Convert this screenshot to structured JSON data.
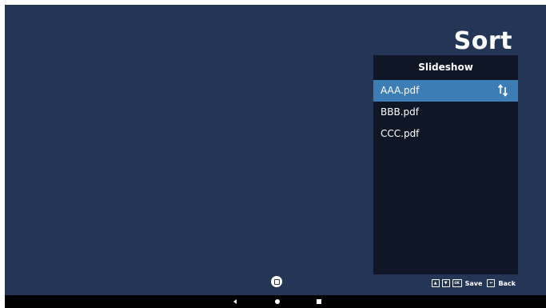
{
  "page": {
    "title": "Sort"
  },
  "panel": {
    "header": "Slideshow",
    "items": [
      {
        "label": "AAA.pdf",
        "selected": true,
        "icon": "sort-arrows-icon"
      },
      {
        "label": "BBB.pdf"
      },
      {
        "label": "CCC.pdf"
      }
    ]
  },
  "hints": {
    "up_icon": "▲",
    "down_icon": "▼",
    "ok_icon": "OK",
    "save_label": "Save",
    "back_icon": "↩",
    "back_label": "Back"
  },
  "navbar": {
    "icons": [
      "back-icon",
      "home-icon",
      "recent-apps-icon"
    ]
  },
  "colors": {
    "background": "#243656",
    "panel": "#0f1626",
    "selected": "#3d7db5",
    "text": "#ffffff"
  }
}
